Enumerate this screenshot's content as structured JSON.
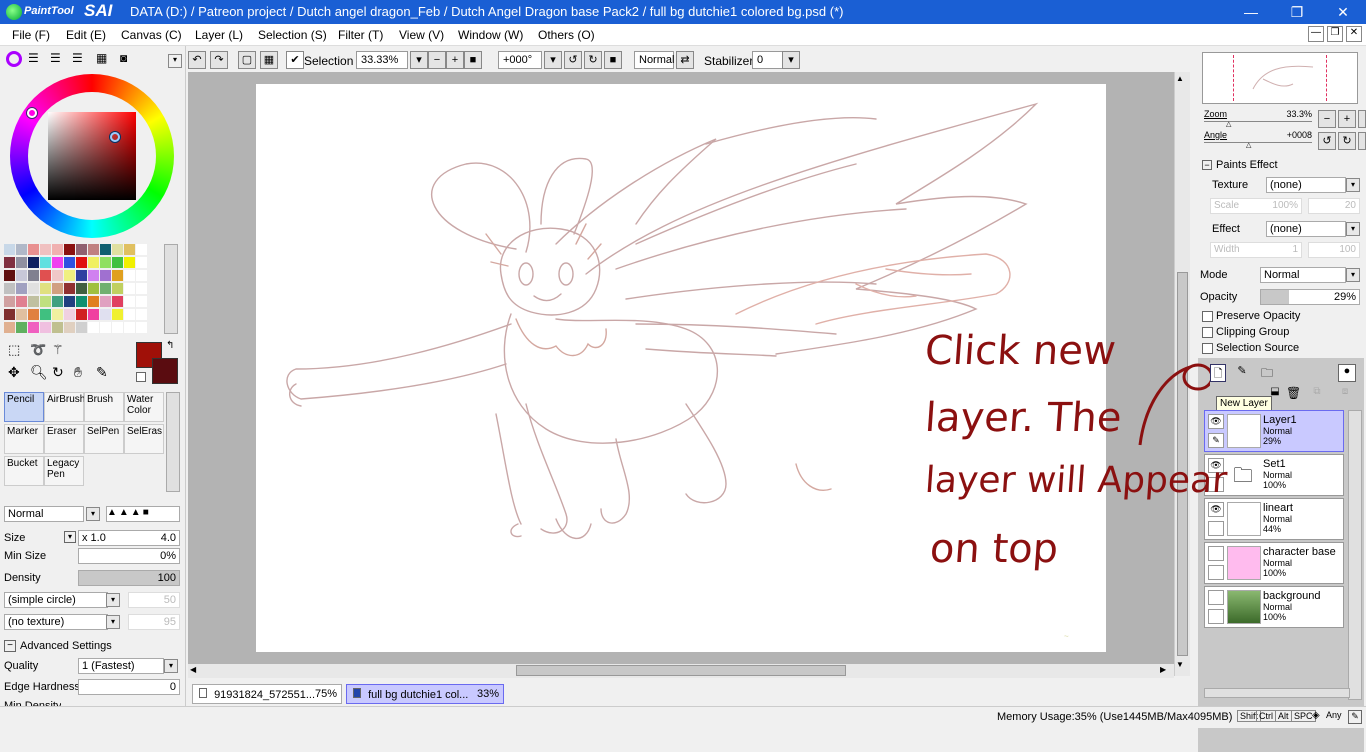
{
  "app": {
    "logo_small": "PaintTool",
    "logo_big": "SAI",
    "title": "DATA (D:) / Patreon project / Dutch angel dragon_Feb / Dutch Angel Dragon base Pack2 / full bg dutchie1 colored bg.psd (*)"
  },
  "menu": [
    "File (F)",
    "Edit (E)",
    "Canvas (C)",
    "Layer (L)",
    "Selection (S)",
    "Filter (T)",
    "View (V)",
    "Window (W)",
    "Others (O)"
  ],
  "toolbar": {
    "selection_label": "Selection",
    "zoom": "33.33%",
    "rotation": "+000°",
    "blend": "Normal",
    "stabilizer_label": "Stabilizer",
    "stabilizer_value": "0"
  },
  "swatches": [
    "#c8d8e8",
    "#b0b8c8",
    "#e89090",
    "#f0c0c0",
    "#f0b0b0",
    "#8a1010",
    "#906070",
    "#c08080",
    "#106070",
    "#e0e0a0",
    "#e0c060",
    "#ffffff",
    "#803040",
    "#9090a0",
    "#102060",
    "#60e0e0",
    "#f040f0",
    "#3050e0",
    "#e01010",
    "#f0f060",
    "#90e060",
    "#40c040",
    "#f0f000",
    "#ffffff",
    "#601010",
    "#c8c8d8",
    "#808090",
    "#e05050",
    "#f0c8c8",
    "#f0f080",
    "#3040a0",
    "#d080f0",
    "#a070d0",
    "#e0a020",
    "#ffffff",
    "#ffffff",
    "#c0c0c0",
    "#a0a0c0",
    "#e0e0e0",
    "#e0e080",
    "#d0a080",
    "#903030",
    "#406040",
    "#a0c040",
    "#70b070",
    "#c0d060",
    "#ffffff",
    "#ffffff",
    "#d0a0a0",
    "#e08090",
    "#c0c0a0",
    "#c0e080",
    "#40a080",
    "#204080",
    "#109070",
    "#e08020",
    "#e0a0c0",
    "#e04060",
    "#ffffff",
    "#ffffff",
    "#803030",
    "#e0c0a0",
    "#e08040",
    "#40c080",
    "#f0f0a0",
    "#f0d0e0",
    "#d02020",
    "#f040a0",
    "#e0e0f0",
    "#f0f030",
    "#ffffff",
    "#ffffff",
    "#e0b090",
    "#60b060",
    "#f060c0",
    "#f0c0e0",
    "#c0c090",
    "#e0d0c0",
    "#d0d0d0",
    "#ffffff",
    "#ffffff",
    "#ffffff",
    "#ffffff",
    "#ffffff"
  ],
  "colors": {
    "primary": "#a01008",
    "secondary": "#5a0c10",
    "selected_layer": "#c9c9ff",
    "annotation": "#8b1010"
  },
  "tools": [
    {
      "name": "Pencil",
      "selected": true
    },
    {
      "name": "AirBrush"
    },
    {
      "name": "Brush"
    },
    {
      "name": "Water Color"
    },
    {
      "name": "Marker"
    },
    {
      "name": "Eraser"
    },
    {
      "name": "SelPen"
    },
    {
      "name": "SelEras"
    },
    {
      "name": "Bucket"
    },
    {
      "name": "Legacy Pen"
    }
  ],
  "brush": {
    "blend": "Normal",
    "size_label": "Size",
    "size_mult": "x 1.0",
    "size_value": "4.0",
    "min_size_label": "Min Size",
    "min_size_value": "0%",
    "density_label": "Density",
    "density_value": "100",
    "shape": "(simple circle)",
    "shape_value": "50",
    "texture": "(no texture)",
    "texture_value": "95",
    "advanced_label": "Advanced Settings",
    "quality_label": "Quality",
    "quality_value": "1 (Fastest)",
    "edge_label": "Edge Hardness",
    "edge_value": "0",
    "min_density_label": "Min Density"
  },
  "navigator": {
    "zoom_label": "Zoom",
    "zoom_value": "33.3%",
    "angle_label": "Angle",
    "angle_value": "+0008"
  },
  "paints_effect": {
    "header": "Paints Effect",
    "texture_label": "Texture",
    "texture_value": "(none)",
    "scale_label": "Scale",
    "scale_value": "100%",
    "scale_num": "20",
    "effect_label": "Effect",
    "effect_value": "(none)",
    "width_label": "Width",
    "width_value": "1",
    "width_num": "100"
  },
  "layer_props": {
    "mode_label": "Mode",
    "mode_value": "Normal",
    "opacity_label": "Opacity",
    "opacity_value": "29%",
    "opacity_fraction": 0.29,
    "preserve_opacity": "Preserve Opacity",
    "clipping_group": "Clipping Group",
    "selection_source": "Selection Source"
  },
  "tooltip": "New Layer",
  "layers": [
    {
      "name": "Layer1",
      "mode": "Normal",
      "opacity": "29%",
      "selected": true,
      "visible": true
    },
    {
      "name": "Set1",
      "mode": "Normal",
      "opacity": "100%",
      "visible": true
    },
    {
      "name": "lineart",
      "mode": "Normal",
      "opacity": "44%",
      "visible": true
    },
    {
      "name": "character base",
      "mode": "Normal",
      "opacity": "100%",
      "visible": false
    },
    {
      "name": "background",
      "mode": "Normal",
      "opacity": "100%",
      "visible": false
    }
  ],
  "doc_tabs": [
    {
      "name": "91931824_572551...",
      "zoom": "75%"
    },
    {
      "name": "full bg dutchie1 col...",
      "zoom": "33%",
      "active": true
    }
  ],
  "annotation": {
    "line1": "Click new",
    "line2": "layer. The",
    "line3": "layer will Appear",
    "line4": "on top"
  },
  "status": {
    "memory": "Memory Usage:35% (Use1445MB/Max4095MB)",
    "keys": [
      "Shift",
      "Ctrl",
      "Alt",
      "SPC",
      "Any"
    ]
  }
}
